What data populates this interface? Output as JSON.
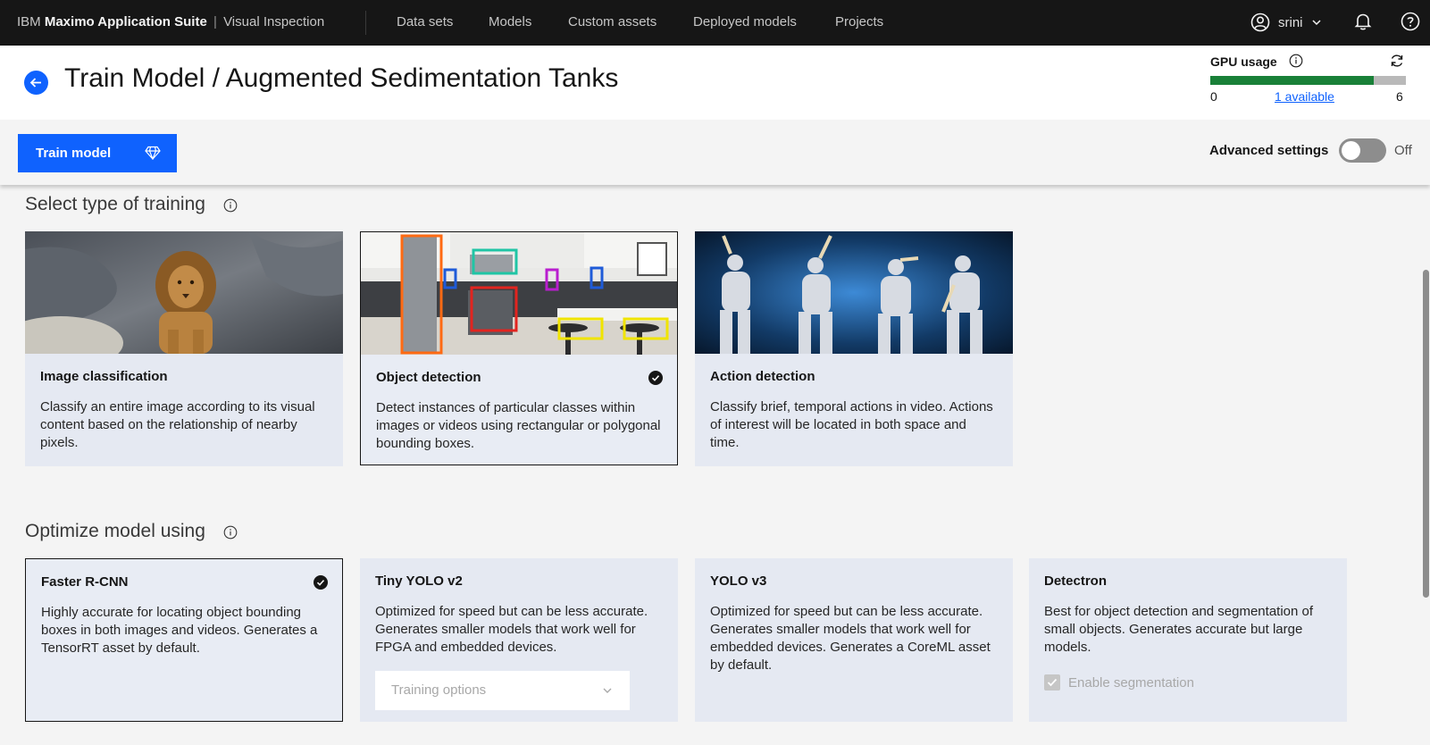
{
  "nav": {
    "brand_prefix": "IBM",
    "brand_bold": "Maximo Application Suite",
    "brand_sep": "|",
    "brand_product": "Visual Inspection",
    "items": [
      "Data sets",
      "Models",
      "Custom assets",
      "Deployed models",
      "Projects"
    ],
    "user_name": "srini",
    "icons": [
      "user-avatar-icon",
      "chevron-down-icon",
      "notification-icon",
      "help-icon"
    ]
  },
  "header": {
    "title": "Train Model / Augmented Sedimentation Tanks",
    "gpu": {
      "label": "GPU usage",
      "min": "0",
      "available_text": "1 available",
      "max": "6",
      "used": 5,
      "total": 6,
      "used_color": "#198038"
    }
  },
  "toolbar": {
    "train_label": "Train model",
    "advanced_label": "Advanced settings",
    "advanced_state": "Off"
  },
  "training_type": {
    "section_title": "Select type of training",
    "cards": [
      {
        "title": "Image classification",
        "description": "Classify an entire image according to its visual content based on the relationship of nearby pixels.",
        "selected": false,
        "image": "lion-photo"
      },
      {
        "title": "Object detection",
        "description": "Detect instances of particular classes within images or videos using rectangular or polygonal bounding boxes.",
        "selected": true,
        "image": "kitchen-with-bounding-boxes"
      },
      {
        "title": "Action detection",
        "description": "Classify brief, temporal actions in video. Actions of interest will be located in both space and time.",
        "selected": false,
        "image": "baseball-swing-sequence"
      }
    ]
  },
  "optimize": {
    "section_title": "Optimize model using",
    "cards": [
      {
        "title": "Faster R-CNN",
        "description": "Highly accurate for locating object bounding boxes in both images and videos. Generates a TensorRT asset by default.",
        "selected": true
      },
      {
        "title": "Tiny YOLO v2",
        "description": "Optimized for speed but can be less accurate. Generates smaller models that work well for FPGA and embedded devices.",
        "selected": false,
        "dropdown_placeholder": "Training options"
      },
      {
        "title": "YOLO v3",
        "description": "Optimized for speed but can be less accurate. Generates smaller models that work well for embedded devices. Generates a CoreML asset by default.",
        "selected": false
      },
      {
        "title": "Detectron",
        "description": "Best for object detection and segmentation of small objects. Generates accurate but large models.",
        "selected": false,
        "checkbox_label": "Enable segmentation",
        "checkbox_checked": true,
        "checkbox_disabled": true
      }
    ]
  }
}
